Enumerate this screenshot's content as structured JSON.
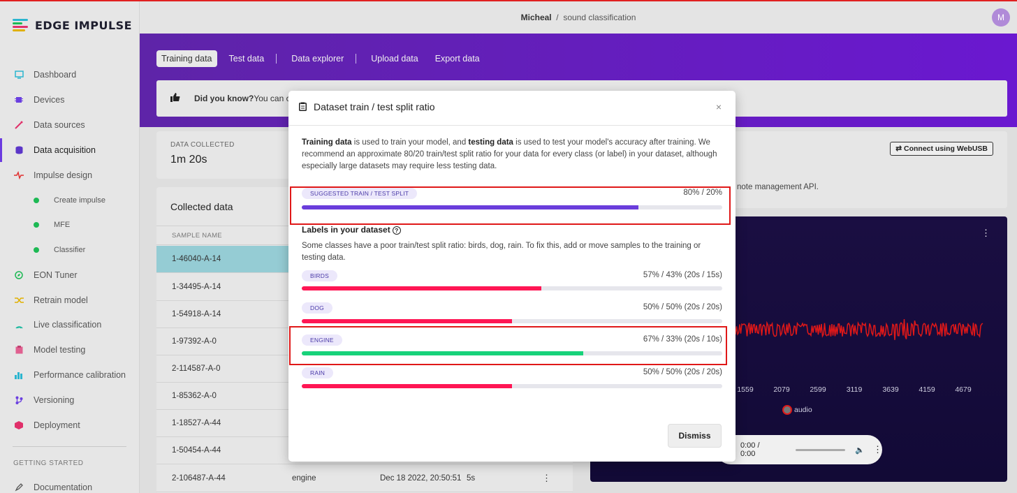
{
  "app": {
    "name": "EDGE IMPULSE"
  },
  "breadcrumb": {
    "user": "Micheal",
    "separator": "/",
    "project": "sound classification"
  },
  "avatar": {
    "initial": "M"
  },
  "sidebar": {
    "items": [
      {
        "label": "Dashboard",
        "icon": "monitor-icon",
        "color": "#2bb5cf"
      },
      {
        "label": "Devices",
        "icon": "chip-icon",
        "color": "#6a3fe0"
      },
      {
        "label": "Data sources",
        "icon": "wand-icon",
        "color": "#e0306a"
      },
      {
        "label": "Data acquisition",
        "icon": "database-icon",
        "color": "#5b36c8",
        "active": true
      },
      {
        "label": "Impulse design",
        "icon": "pulse-icon",
        "color": "#e03030"
      },
      {
        "label": "EON Tuner",
        "icon": "compass-icon",
        "color": "#1db954"
      },
      {
        "label": "Retrain model",
        "icon": "shuffle-icon",
        "color": "#e0b000"
      },
      {
        "label": "Live classification",
        "icon": "signal-icon",
        "color": "#1db9a0"
      },
      {
        "label": "Model testing",
        "icon": "clipboard-icon",
        "color": "#e06090"
      },
      {
        "label": "Performance calibration",
        "icon": "chart-icon",
        "color": "#2bb5cf"
      },
      {
        "label": "Versioning",
        "icon": "branch-icon",
        "color": "#6a3fe0"
      },
      {
        "label": "Deployment",
        "icon": "cube-icon",
        "color": "#e0306a"
      }
    ],
    "subitems": [
      {
        "label": "Create impulse"
      },
      {
        "label": "MFE"
      },
      {
        "label": "Classifier"
      }
    ],
    "section_heading": "GETTING STARTED",
    "doc_item": {
      "label": "Documentation",
      "icon": "rocket-icon"
    }
  },
  "tabs": [
    {
      "label": "Training data",
      "active": true
    },
    {
      "label": "Test data"
    },
    {
      "label": "Data explorer"
    },
    {
      "label": "Upload data"
    },
    {
      "label": "Export data"
    }
  ],
  "info_bar": {
    "bold": "Did you know?",
    "text": " You can c"
  },
  "stats": {
    "label": "DATA COLLECTED",
    "value": "1m 20s"
  },
  "collected": {
    "title": "Collected data",
    "column": "SAMPLE NAME",
    "rows": [
      {
        "name": "1-46040-A-14",
        "selected": true
      },
      {
        "name": "1-34495-A-14"
      },
      {
        "name": "1-54918-A-14"
      },
      {
        "name": "1-97392-A-0"
      },
      {
        "name": "2-114587-A-0"
      },
      {
        "name": "1-85362-A-0"
      },
      {
        "name": "1-18527-A-44"
      },
      {
        "name": "1-50454-A-44"
      },
      {
        "name": "2-106487-A-44",
        "label": "engine",
        "added": "Dec 18 2022, 20:50:51",
        "length": "5s",
        "menu": "⋮"
      }
    ]
  },
  "device_panel": {
    "button": "Connect using WebUSB",
    "text": "note management API."
  },
  "waveform": {
    "x_ticks": [
      "1559",
      "2079",
      "2599",
      "3119",
      "3639",
      "4159",
      "4679"
    ],
    "legend": "audio",
    "series_color": "#e01818",
    "player": {
      "time": "0:00 / 0:00"
    }
  },
  "modal": {
    "title": "Dataset train / test split ratio",
    "close": "×",
    "desc_bold1": "Training data",
    "desc_mid1": " is used to train your model, and ",
    "desc_bold2": "testing data",
    "desc_rest": " is used to test your model's accuracy after training. We recommend an approximate 80/20 train/test split ratio for your data for every class (or label) in your dataset, although especially large datasets may require less testing data.",
    "suggested": {
      "label": "SUGGESTED TRAIN / TEST SPLIT",
      "ratio": "80% / 20%",
      "fraction": 0.8,
      "color": "#6a3ddb"
    },
    "labels_title": "Labels in your dataset",
    "labels_help": "?",
    "warning": "Some classes have a poor train/test split ratio: birds, dog, rain. To fix this, add or move samples to the training or testing data.",
    "classes": [
      {
        "label": "BIRDS",
        "ratio": "57% / 43% (20s / 15s)",
        "fraction": 0.57,
        "color": "#ff1654"
      },
      {
        "label": "DOG",
        "ratio": "50% / 50% (20s / 20s)",
        "fraction": 0.5,
        "color": "#ff1654"
      },
      {
        "label": "ENGINE",
        "ratio": "67% / 33% (20s / 10s)",
        "fraction": 0.67,
        "color": "#18d27a"
      },
      {
        "label": "RAIN",
        "ratio": "50% / 50% (20s / 20s)",
        "fraction": 0.5,
        "color": "#ff1654"
      }
    ],
    "dismiss": "Dismiss"
  }
}
